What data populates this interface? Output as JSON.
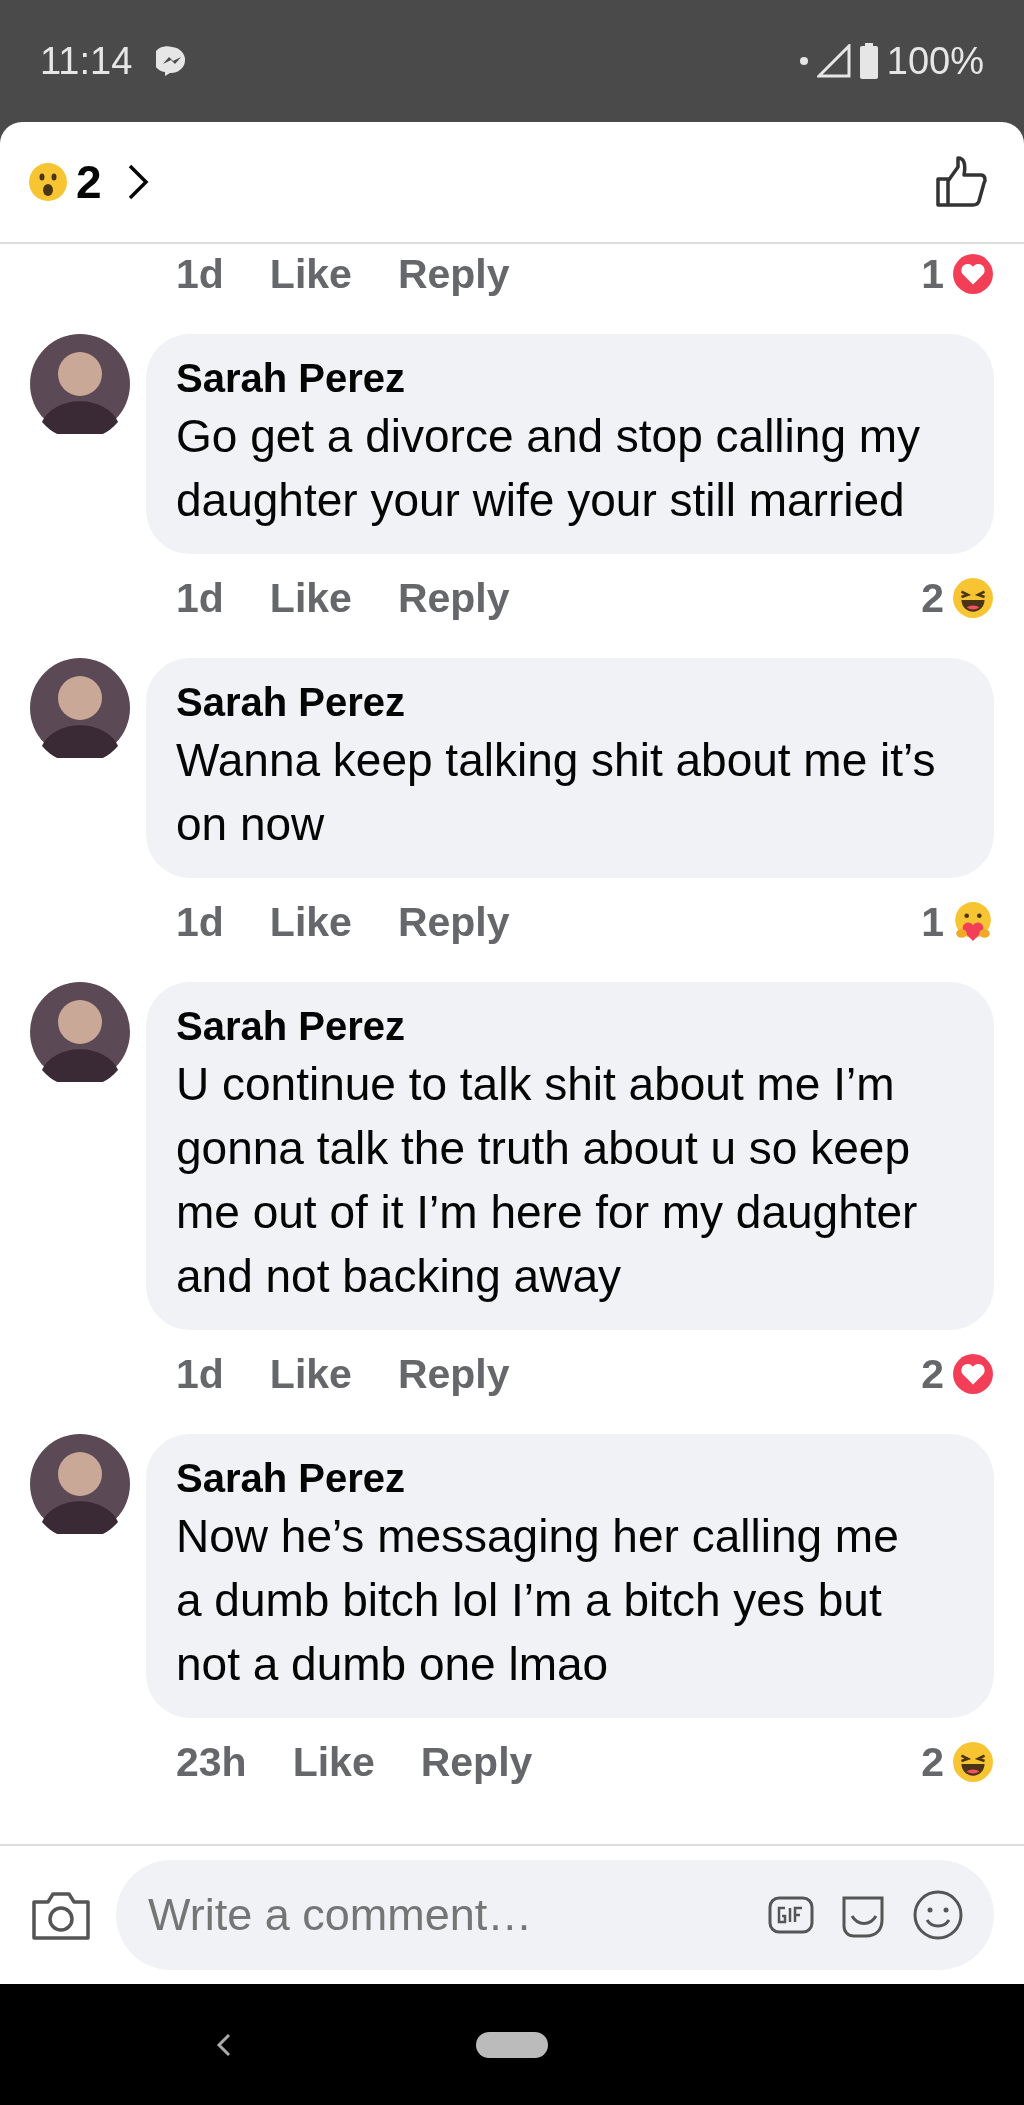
{
  "status_bar": {
    "time": "11:14",
    "battery": "100%"
  },
  "header": {
    "reaction": {
      "kind": "wow",
      "count": "2"
    }
  },
  "top_meta": {
    "time": "1d",
    "like": "Like",
    "reply": "Reply",
    "reaction": {
      "kind": "love",
      "count": "1"
    }
  },
  "comments": [
    {
      "author": "Sarah Perez",
      "text": "Go get a divorce and stop calling my daughter your wife your still married",
      "time": "1d",
      "like": "Like",
      "reply": "Reply",
      "reaction": {
        "kind": "haha",
        "count": "2"
      }
    },
    {
      "author": "Sarah Perez",
      "text": "Wanna keep talking shit about me it’s on now",
      "time": "1d",
      "like": "Like",
      "reply": "Reply",
      "reaction": {
        "kind": "care",
        "count": "1"
      }
    },
    {
      "author": "Sarah Perez",
      "text": "U continue to talk shit about me I’m gonna talk the truth about u so keep me out of it I’m here for my daughter and not backing away",
      "time": "1d",
      "like": "Like",
      "reply": "Reply",
      "reaction": {
        "kind": "love",
        "count": "2"
      }
    },
    {
      "author": "Sarah Perez",
      "text": "Now he’s messaging her calling me a dumb bitch lol I’m a bitch yes but not a dumb one lmao",
      "time": "23h",
      "like": "Like",
      "reply": "Reply",
      "reaction": {
        "kind": "haha",
        "count": "2"
      }
    }
  ],
  "composer": {
    "placeholder": "Write a comment…"
  }
}
